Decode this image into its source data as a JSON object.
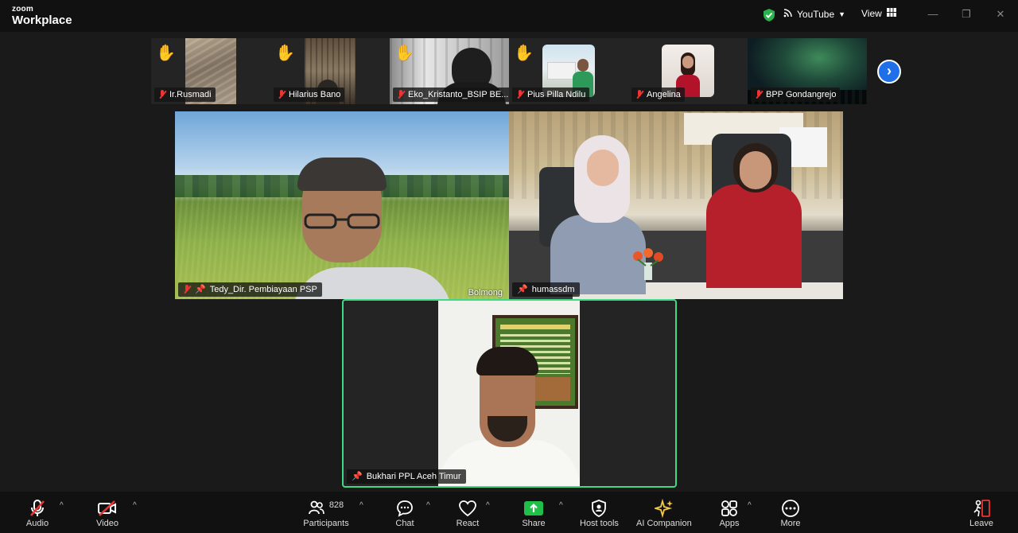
{
  "app": {
    "logo_top": "zoom",
    "logo_bottom": "Workplace",
    "youtube_label": "YouTube",
    "view_label": "View"
  },
  "strip": {
    "tiles": [
      {
        "name": "Ir.Rusmadi",
        "hand": "✋"
      },
      {
        "name": "Hilarius Bano",
        "hand": "✋"
      },
      {
        "name": "Eko_Kristanto_BSIP BE...",
        "hand": "✋"
      },
      {
        "name": "Pius Pilla Ndilu",
        "hand": "✋"
      },
      {
        "name": "Angelina"
      },
      {
        "name": "BPP Gondangrejo"
      }
    ],
    "next": "›"
  },
  "main": {
    "tiles": [
      {
        "name": "Tedy_Dir. Pembiayaan PSP",
        "overlay_text": "Bolmong"
      },
      {
        "name": "humassdm"
      },
      {
        "name": "Bukhari  PPL Aceh Timur"
      }
    ]
  },
  "toolbar": {
    "audio": "Audio",
    "video": "Video",
    "participants": "Participants",
    "participants_count": "828",
    "chat": "Chat",
    "react": "React",
    "share": "Share",
    "host_tools": "Host tools",
    "ai_companion": "AI Companion",
    "apps": "Apps",
    "more": "More",
    "leave": "Leave"
  },
  "colors": {
    "active_speaker_border": "#3ddc84",
    "share_green": "#1fbf4a",
    "mute_red": "#e33333",
    "next_blue": "#1f6fe8"
  }
}
